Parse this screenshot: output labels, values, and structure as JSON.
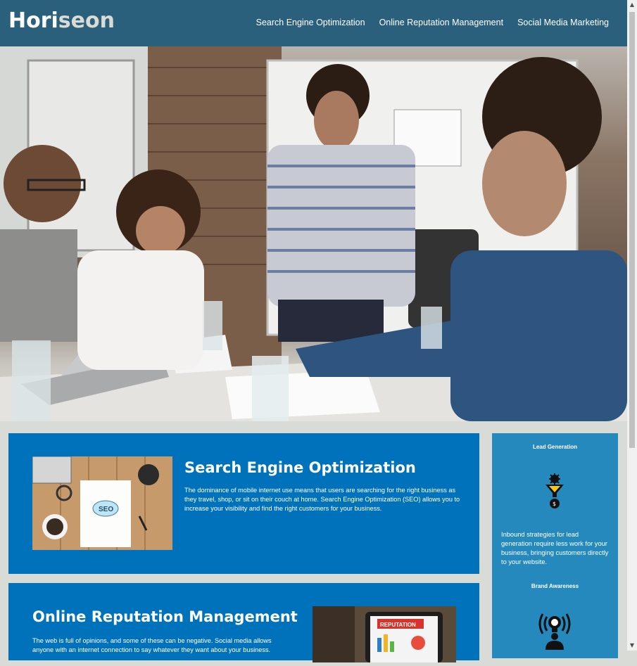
{
  "header": {
    "logo_main": "Hori",
    "logo_accent": "seon",
    "nav": [
      "Search Engine Optimization",
      "Online Reputation Management",
      "Social Media Marketing"
    ]
  },
  "content": [
    {
      "title": "Search Engine Optimization",
      "text": "The dominance of mobile internet use means that users are searching for the right business as they travel, shop, or sit on their couch at home. Search Engine Optimization (SEO) allows you to increase your visibility and find the right customers for your business.",
      "image_label": "SEO"
    },
    {
      "title": "Online Reputation Management",
      "text": "The web is full of opinions, and some of these can be negative. Social media allows anyone with an internet connection to say whatever they want about your business.",
      "image_label": "REPUTATION"
    }
  ],
  "benefits": [
    {
      "title": "Lead Generation",
      "text": "Inbound strategies for lead generation require less work for your business, bringing customers directly to your website.",
      "icon": "lead-generation-icon"
    },
    {
      "title": "Brand Awareness",
      "icon": "brand-awareness-icon"
    }
  ],
  "colors": {
    "header": "#2a607c",
    "card": "#0072bb",
    "sidebar": "#2589bd",
    "background": "#d9dcd6"
  }
}
